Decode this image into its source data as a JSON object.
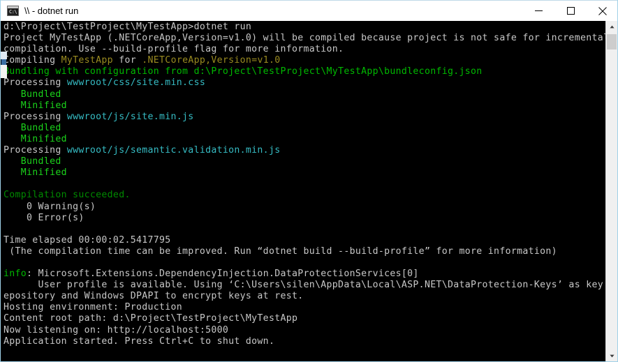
{
  "window": {
    "title": "\\\\ - dotnet  run",
    "icon": "console-icon",
    "icon_glyph": "C:\\",
    "minimize_label": "Minimize",
    "maximize_label": "Maximize",
    "close_label": "Close"
  },
  "colors": {
    "default_text": "#c8c8c8",
    "green": "#00b900",
    "bright_green": "#1bd41b",
    "dark_green": "#008a00",
    "cyan": "#36bcc4",
    "yellow": "#9a8b20",
    "background": "#000000",
    "chrome": "#ffffff"
  },
  "scrollbar": {
    "up_arrow": "scroll-up-arrow",
    "down_arrow": "scroll-down-arrow",
    "thumb": "scrollbar-thumb"
  },
  "console": {
    "lines": [
      [
        {
          "t": "d:\\Project\\TestProject\\MyTestApp>dotnet run",
          "c": "white"
        }
      ],
      [
        {
          "t": "Project MyTestApp (.NETCoreApp,Version=v1.0) will be compiled because project is not safe for incremental",
          "c": "white"
        }
      ],
      [
        {
          "t": "compilation. Use --build-profile flag for more information.",
          "c": "white"
        }
      ],
      [
        {
          "t": "Compiling ",
          "c": "white"
        },
        {
          "t": "MyTestApp",
          "c": "yellow"
        },
        {
          "t": " for ",
          "c": "white"
        },
        {
          "t": ".NETCoreApp,Version=v1.0",
          "c": "yellow"
        }
      ],
      [
        {
          "t": "Bundling with configuration from d:\\Project\\TestProject\\MyTestApp\\bundleconfig.json",
          "c": "green"
        }
      ],
      [
        {
          "t": "Processing ",
          "c": "white"
        },
        {
          "t": "wwwroot/css/site.min.css",
          "c": "cyan"
        }
      ],
      [
        {
          "t": "   ",
          "c": "white"
        },
        {
          "t": "Bundled",
          "c": "bgreen"
        }
      ],
      [
        {
          "t": "   ",
          "c": "white"
        },
        {
          "t": "Minified",
          "c": "bgreen"
        }
      ],
      [
        {
          "t": "Processing ",
          "c": "white"
        },
        {
          "t": "wwwroot/js/site.min.js",
          "c": "cyan"
        }
      ],
      [
        {
          "t": "   ",
          "c": "white"
        },
        {
          "t": "Bundled",
          "c": "bgreen"
        }
      ],
      [
        {
          "t": "   ",
          "c": "white"
        },
        {
          "t": "Minified",
          "c": "bgreen"
        }
      ],
      [
        {
          "t": "Processing ",
          "c": "white"
        },
        {
          "t": "wwwroot/js/semantic.validation.min.js",
          "c": "cyan"
        }
      ],
      [
        {
          "t": "   ",
          "c": "white"
        },
        {
          "t": "Bundled",
          "c": "bgreen"
        }
      ],
      [
        {
          "t": "   ",
          "c": "white"
        },
        {
          "t": "Minified",
          "c": "bgreen"
        }
      ],
      [
        {
          "t": "",
          "c": "white"
        }
      ],
      [
        {
          "t": "Compilation succeeded.",
          "c": "dgreen"
        }
      ],
      [
        {
          "t": "    0 Warning(s)",
          "c": "white"
        }
      ],
      [
        {
          "t": "    0 Error(s)",
          "c": "white"
        }
      ],
      [
        {
          "t": "",
          "c": "white"
        }
      ],
      [
        {
          "t": "Time elapsed 00:00:02.5417795",
          "c": "white"
        }
      ],
      [
        {
          "t": " (The compilation time can be improved. Run “dotnet build --build-profile” for more information)",
          "c": "white"
        }
      ],
      [
        {
          "t": "",
          "c": "white"
        }
      ],
      [
        {
          "t": "info",
          "c": "green"
        },
        {
          "t": ": Microsoft.Extensions.DependencyInjection.DataProtectionServices[0]",
          "c": "white"
        }
      ],
      [
        {
          "t": "      User profile is available. Using ‘C:\\Users\\silen\\AppData\\Local\\ASP.NET\\DataProtection-Keys’ as key r",
          "c": "white"
        }
      ],
      [
        {
          "t": "epository and Windows DPAPI to encrypt keys at rest.",
          "c": "white"
        }
      ],
      [
        {
          "t": "Hosting environment: Production",
          "c": "white"
        }
      ],
      [
        {
          "t": "Content root path: d:\\Project\\TestProject\\MyTestApp",
          "c": "white"
        }
      ],
      [
        {
          "t": "Now listening on: http://localhost:5000",
          "c": "white"
        }
      ],
      [
        {
          "t": "Application started. Press Ctrl+C to shut down.",
          "c": "white"
        }
      ]
    ]
  }
}
